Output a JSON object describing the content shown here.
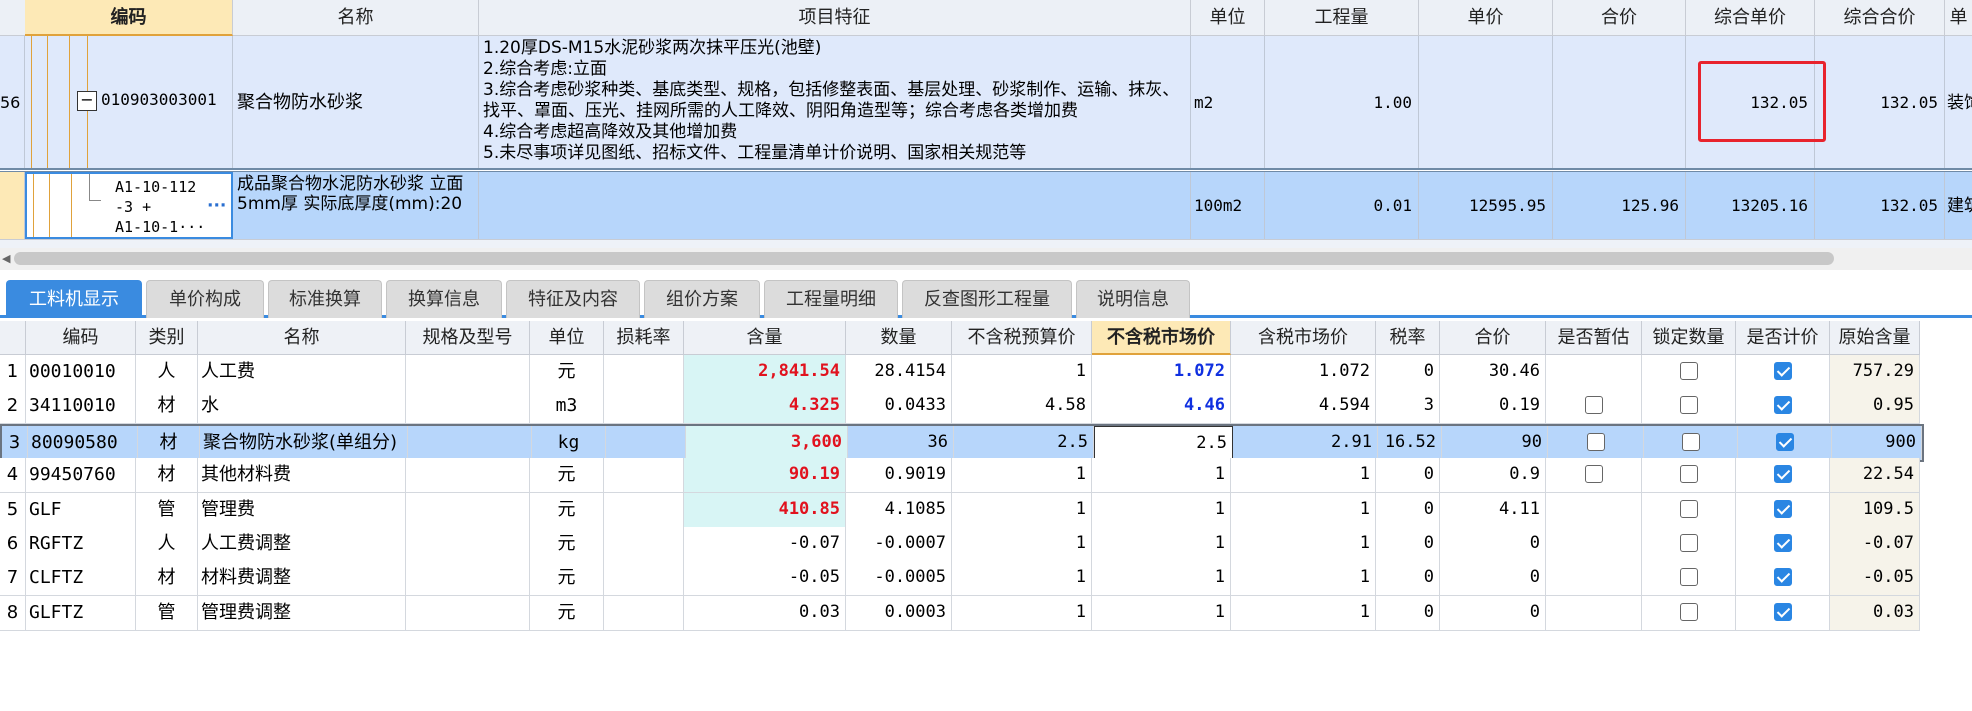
{
  "top_grid": {
    "columns": [
      "编码",
      "名称",
      "项目特征",
      "单位",
      "工程量",
      "单价",
      "合价",
      "综合单价",
      "综合合价",
      "单"
    ],
    "row1": {
      "index": "56",
      "expand_symbol": "−",
      "code": "010903003001",
      "name": "聚合物防水砂浆",
      "features": [
        "1.20厚DS-M15水泥砂浆两次抹平压光(池壁)",
        "2.综合考虑:立面",
        "3.综合考虑砂浆种类、基底类型、规格，包括修整表面、基层处理、砂浆制作、运输、抹灰、找平、罩面、压光、挂网所需的人工降效、阴阳角造型等；综合考虑各类增加费",
        "4.综合考虑超高降效及其他增加费",
        "5.未尽事项详见图纸、招标文件、工程量清单计价说明、国家相关规范等"
      ],
      "unit": "m2",
      "quantity": "1.00",
      "unit_price": "",
      "total_price": "",
      "composite_unit_price": "132.05",
      "composite_total": "132.05",
      "extra": "装饰"
    },
    "row2": {
      "code_lines": [
        "A1-10-112",
        "-3 +",
        "A1-10-1···"
      ],
      "more": "···",
      "name": "成品聚合物水泥防水砂浆 立面 5mm厚  实际底厚度(mm):20",
      "unit": "100m2",
      "quantity": "0.01",
      "unit_price": "12595.95",
      "total_price": "125.96",
      "composite_unit_price": "13205.16",
      "composite_total": "132.05",
      "extra": "建筑"
    }
  },
  "tabs": [
    "工料机显示",
    "单价构成",
    "标准换算",
    "换算信息",
    "特征及内容",
    "组价方案",
    "工程量明细",
    "反查图形工程量",
    "说明信息"
  ],
  "bottom_grid": {
    "columns": [
      "编码",
      "类别",
      "名称",
      "规格及型号",
      "单位",
      "损耗率",
      "含量",
      "数量",
      "不含税预算价",
      "不含税市场价",
      "含税市场价",
      "税率",
      "合价",
      "是否暂估",
      "锁定数量",
      "是否计价",
      "原始含量"
    ],
    "rows": [
      {
        "no": "1",
        "code": "00010010",
        "cat": "人",
        "name": "人工费",
        "spec": "",
        "unit": "元",
        "loss": "",
        "content": "2,841.54",
        "qty": "28.4154",
        "budget": "1",
        "market": "1.072",
        "tax_market": "1.072",
        "rate": "0",
        "total": "30.46",
        "est": null,
        "lock": false,
        "priced": true,
        "orig": "757.29"
      },
      {
        "no": "2",
        "code": "34110010",
        "cat": "材",
        "name": "水",
        "spec": "",
        "unit": "m3",
        "loss": "",
        "content": "4.325",
        "qty": "0.0433",
        "budget": "4.58",
        "market": "4.46",
        "tax_market": "4.594",
        "rate": "3",
        "total": "0.19",
        "est": false,
        "lock": false,
        "priced": true,
        "orig": "0.95"
      },
      {
        "no": "3",
        "code": "80090580",
        "cat": "材",
        "name": "聚合物防水砂浆(单组分)",
        "spec": "",
        "unit": "kg",
        "loss": "",
        "content": "3,600",
        "qty": "36",
        "budget": "2.5",
        "market": "2.5",
        "tax_market": "2.91",
        "rate": "16.52",
        "total": "90",
        "est": false,
        "lock": false,
        "priced": true,
        "orig": "900"
      },
      {
        "no": "4",
        "code": "99450760",
        "cat": "材",
        "name": "其他材料费",
        "spec": "",
        "unit": "元",
        "loss": "",
        "content": "90.19",
        "qty": "0.9019",
        "budget": "1",
        "market": "1",
        "tax_market": "1",
        "rate": "0",
        "total": "0.9",
        "est": false,
        "lock": false,
        "priced": true,
        "orig": "22.54"
      },
      {
        "no": "5",
        "code": "GLF",
        "cat": "管",
        "name": "管理费",
        "spec": "",
        "unit": "元",
        "loss": "",
        "content": "410.85",
        "qty": "4.1085",
        "budget": "1",
        "market": "1",
        "tax_market": "1",
        "rate": "0",
        "total": "4.11",
        "est": null,
        "lock": false,
        "priced": true,
        "orig": "109.5"
      },
      {
        "no": "6",
        "code": "RGFTZ",
        "cat": "人",
        "name": "人工费调整",
        "spec": "",
        "unit": "元",
        "loss": "",
        "content": "-0.07",
        "qty": "-0.0007",
        "budget": "1",
        "market": "1",
        "tax_market": "1",
        "rate": "0",
        "total": "0",
        "est": null,
        "lock": false,
        "priced": true,
        "orig": "-0.07"
      },
      {
        "no": "7",
        "code": "CLFTZ",
        "cat": "材",
        "name": "材料费调整",
        "spec": "",
        "unit": "元",
        "loss": "",
        "content": "-0.05",
        "qty": "-0.0005",
        "budget": "1",
        "market": "1",
        "tax_market": "1",
        "rate": "0",
        "total": "0",
        "est": null,
        "lock": false,
        "priced": true,
        "orig": "-0.05"
      },
      {
        "no": "8",
        "code": "GLFTZ",
        "cat": "管",
        "name": "管理费调整",
        "spec": "",
        "unit": "元",
        "loss": "",
        "content": "0.03",
        "qty": "0.0003",
        "budget": "1",
        "market": "1",
        "tax_market": "1",
        "rate": "0",
        "total": "0",
        "est": null,
        "lock": false,
        "priced": true,
        "orig": "0.03"
      }
    ]
  },
  "colors": {
    "accent": "#3a8be0",
    "selected_row": "#b7d6fb",
    "highlight_red": "#e8232d",
    "content_red": "#e1121e",
    "market_blue": "#1030e0"
  }
}
